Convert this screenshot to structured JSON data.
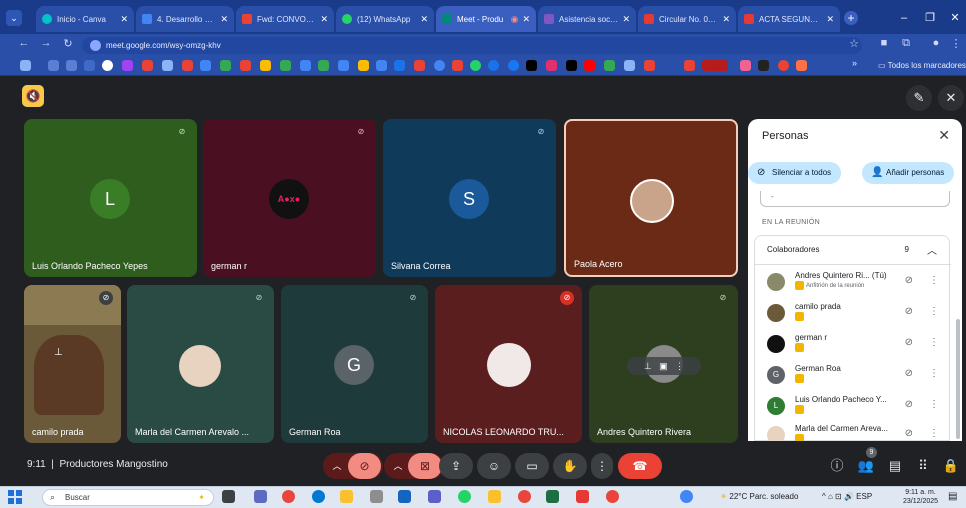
{
  "browser": {
    "tabs": [
      {
        "label": "Inicio - Canva",
        "color": "#00c4cc"
      },
      {
        "label": "4. Desarrollo econ",
        "color": "#4285f4"
      },
      {
        "label": "Fwd: CONVOCATO",
        "color": "#ea4335"
      },
      {
        "label": "(12) WhatsApp",
        "color": "#25d366"
      },
      {
        "label": "Meet - Produ",
        "color": "#00897b"
      },
      {
        "label": "Asistencia sociale",
        "color": "#7e57c2"
      },
      {
        "label": "Circular No. 060 fi",
        "color": "#e53935"
      },
      {
        "label": "ACTA SEGUNDA S",
        "color": "#e53935"
      }
    ],
    "url": "meet.google.com/wsy-omzg-khv",
    "all_bookmarks": "Todos los marcadores",
    "bookmark_overflow": "»"
  },
  "meet": {
    "participants_top": [
      {
        "name": "Luis Orlando Pacheco Yepes",
        "initial": "L",
        "bg": "#2e5d1e",
        "avatar_bg": "#3a7d27"
      },
      {
        "name": "german r",
        "initial": "",
        "bg": "#4a1022",
        "avatar_bg": "#111111"
      },
      {
        "name": "Silvana Correa",
        "initial": "S",
        "bg": "#103a5a",
        "avatar_bg": "#1a5a9a"
      },
      {
        "name": "Paola Acero",
        "initial": "",
        "bg": "#6a2a16",
        "avatar_bg": "#c9a48a"
      }
    ],
    "participants_bottom": [
      {
        "name": "camilo prada",
        "initial": "",
        "bg": "#6a5a3a",
        "avatar_bg": "#6a5a3a"
      },
      {
        "name": "Marla del Carmen Arevalo ...",
        "initial": "",
        "bg": "#2a4a44",
        "avatar_bg": "#e8d3c1"
      },
      {
        "name": "German Roa",
        "initial": "G",
        "bg": "#1f3a3a",
        "avatar_bg": "#5a6368"
      },
      {
        "name": "NICOLAS LEONARDO TRU...",
        "initial": "",
        "bg": "#5a1e1e",
        "avatar_bg": "#f1e8e8"
      },
      {
        "name": "Andres Quintero Rivera",
        "initial": "",
        "bg": "#2e3f1f",
        "avatar_bg": "#8a8a8a"
      }
    ],
    "german_logo_text": "A●x●",
    "meeting_time": "9:11",
    "meeting_separator": "|",
    "meeting_name": "Productores Mangostino",
    "people_badge": "9"
  },
  "panel": {
    "title": "Personas",
    "mute_all": "Silenciar a todos",
    "add_people": "Añadir personas",
    "search_placeholder": "-",
    "in_meeting": "EN LA REUNIÓN",
    "collaborators_label": "Colaboradores",
    "collaborators_count": "9",
    "people": [
      {
        "name": "Andres Quintero Ri... (Tú)",
        "sub": "Anfitrión de la reunión",
        "avatar_bg": "#8a8a6a",
        "initial": ""
      },
      {
        "name": "camilo prada",
        "sub": "",
        "avatar_bg": "#6a5a3a",
        "initial": ""
      },
      {
        "name": "german r",
        "sub": "",
        "avatar_bg": "#111111",
        "initial": ""
      },
      {
        "name": "German Roa",
        "sub": "",
        "avatar_bg": "#5f6368",
        "initial": "G"
      },
      {
        "name": "Luis Orlando Pacheco Y...",
        "sub": "",
        "avatar_bg": "#2e7d32",
        "initial": "L"
      },
      {
        "name": "Marla del Carmen Areva...",
        "sub": "",
        "avatar_bg": "#e8d3c1",
        "initial": ""
      }
    ]
  },
  "taskbar": {
    "search_placeholder": "Buscar",
    "weather": "22°C  Parc. soleado",
    "lang": "ESP",
    "time": "9:11 a. m.",
    "date": "23/12/2025"
  }
}
